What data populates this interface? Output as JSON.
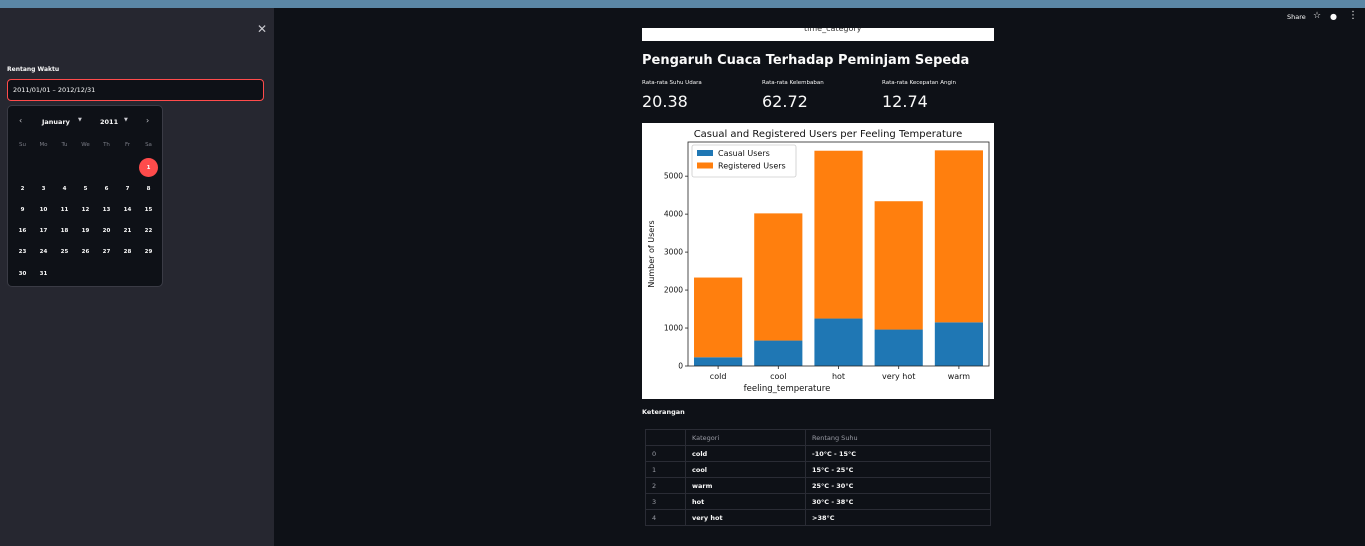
{
  "sidebar": {
    "date_label": "Rentang Waktu",
    "date_value": "2011/01/01 – 2012/12/31",
    "calendar": {
      "month": "January",
      "year": "2011",
      "weekdays": [
        "Su",
        "Mo",
        "Tu",
        "We",
        "Th",
        "Fr",
        "Sa"
      ],
      "days": [
        "1",
        "2",
        "3",
        "4",
        "5",
        "6",
        "7",
        "8",
        "9",
        "10",
        "11",
        "12",
        "13",
        "14",
        "15",
        "16",
        "17",
        "18",
        "19",
        "20",
        "21",
        "22",
        "23",
        "24",
        "25",
        "26",
        "27",
        "28",
        "29",
        "30",
        "31"
      ],
      "selected": "1"
    }
  },
  "toolbar": {
    "share_label": "Share"
  },
  "strip_text": "time_category",
  "section": {
    "title": "Pengaruh Cuaca Terhadap Peminjam Sepeda",
    "metrics": [
      {
        "label": "Rata-rata Suhu Udara",
        "value": "20.38"
      },
      {
        "label": "Rata-rata Kelembaban",
        "value": "62.72"
      },
      {
        "label": "Rata-rata Kecepatan Angin",
        "value": "12.74"
      }
    ]
  },
  "chart_data": {
    "type": "bar",
    "stacked": true,
    "title": "Casual and Registered Users per Feeling Temperature",
    "xlabel": "feeling_temperature",
    "ylabel": "Number of Users",
    "categories": [
      "cold",
      "cool",
      "hot",
      "very hot",
      "warm"
    ],
    "series": [
      {
        "name": "Casual Users",
        "color": "#1f77b4",
        "values": [
          230,
          670,
          1250,
          960,
          1150
        ]
      },
      {
        "name": "Registered Users",
        "color": "#ff7f0e",
        "values": [
          2100,
          3350,
          4420,
          3380,
          4530
        ]
      }
    ],
    "ylim": [
      0,
      5900
    ],
    "yticks": [
      0,
      1000,
      2000,
      3000,
      4000,
      5000
    ],
    "legend": "top-left"
  },
  "keterangan": {
    "title": "Keterangan",
    "headers": [
      "",
      "Kategori",
      "Rentang Suhu"
    ],
    "rows": [
      [
        "0",
        "cold",
        "-10°C - 15°C"
      ],
      [
        "1",
        "cool",
        "15°C - 25°C"
      ],
      [
        "2",
        "warm",
        "25°C - 30°C"
      ],
      [
        "3",
        "hot",
        "30°C - 38°C"
      ],
      [
        "4",
        "very hot",
        ">38°C"
      ]
    ]
  },
  "colors": {
    "accent": "#ff4b4b",
    "bg": "#0e1117",
    "sidebar": "#262730"
  }
}
